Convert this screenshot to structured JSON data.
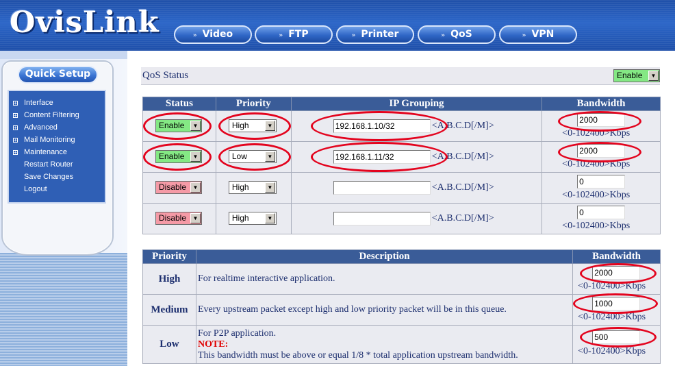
{
  "header": {
    "logo": "OvisLink",
    "nav": [
      {
        "label": "Video"
      },
      {
        "label": "FTP"
      },
      {
        "label": "Printer"
      },
      {
        "label": "QoS"
      },
      {
        "label": "VPN"
      }
    ]
  },
  "sidebar": {
    "quick_setup": "Quick Setup",
    "items": [
      {
        "label": "Interface",
        "expandable": true
      },
      {
        "label": "Content Filtering",
        "expandable": true
      },
      {
        "label": "Advanced",
        "expandable": true
      },
      {
        "label": "Mail Monitoring",
        "expandable": true
      },
      {
        "label": "Maintenance",
        "expandable": true
      },
      {
        "label": "Restart Router",
        "expandable": false
      },
      {
        "label": "Save Changes",
        "expandable": false
      },
      {
        "label": "Logout",
        "expandable": false
      }
    ]
  },
  "qos": {
    "title": "QoS Status",
    "status_value": "Enable"
  },
  "ip_table": {
    "headers": [
      "Status",
      "Priority",
      "IP Grouping",
      "Bandwidth"
    ],
    "ip_hint": "<A.B.C.D[/M]>",
    "bw_hint": "<0-102400>Kbps",
    "rows": [
      {
        "status": "Enable",
        "priority": "High",
        "ip": "192.168.1.10/32",
        "bandwidth": "2000"
      },
      {
        "status": "Enable",
        "priority": "Low",
        "ip": "192.168.1.11/32",
        "bandwidth": "2000"
      },
      {
        "status": "Disable",
        "priority": "High",
        "ip": "",
        "bandwidth": "0"
      },
      {
        "status": "Disable",
        "priority": "High",
        "ip": "",
        "bandwidth": "0"
      }
    ]
  },
  "prio_table": {
    "headers": [
      "Priority",
      "Description",
      "Bandwidth"
    ],
    "bw_hint": "<0-102400>Kbps",
    "rows": [
      {
        "priority": "High",
        "description": "For realtime interactive application.",
        "bandwidth": "2000"
      },
      {
        "priority": "Medium",
        "description": "Every upstream packet except high and low priority packet will be in this queue.",
        "bandwidth": "1000"
      },
      {
        "priority": "Low",
        "description": "For P2P application.",
        "note_label": "NOTE:",
        "note_text": "This bandwidth must be above or equal 1/8 * total application upstream bandwidth.",
        "bandwidth": "500"
      }
    ]
  },
  "colors": {
    "header_blue": "#2c66c8",
    "table_header": "#3a5c98",
    "enable_green": "#84e884",
    "disable_pink": "#f59aa6",
    "annotation_red": "#e3041e"
  }
}
